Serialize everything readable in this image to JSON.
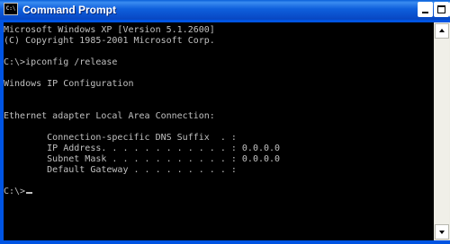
{
  "window": {
    "title": "Command Prompt",
    "icon": "console-icon",
    "icon_label": "C:\\",
    "controls": [
      "minimize",
      "maximize",
      "close"
    ],
    "close_glyph": "×"
  },
  "console": {
    "lines": [
      "Microsoft Windows XP [Version 5.1.2600]",
      "(C) Copyright 1985-2001 Microsoft Corp.",
      "",
      "C:\\>ipconfig /release",
      "",
      "Windows IP Configuration",
      "",
      "",
      "Ethernet adapter Local Area Connection:",
      "",
      "        Connection-specific DNS Suffix  . :",
      "        IP Address. . . . . . . . . . . . : 0.0.0.0",
      "        Subnet Mask . . . . . . . . . . . : 0.0.0.0",
      "        Default Gateway . . . . . . . . . :",
      "",
      "C:\\>"
    ]
  },
  "colors": {
    "titlebar": "#0054e3",
    "console_bg": "#000000",
    "console_fg": "#c0c0c0"
  }
}
